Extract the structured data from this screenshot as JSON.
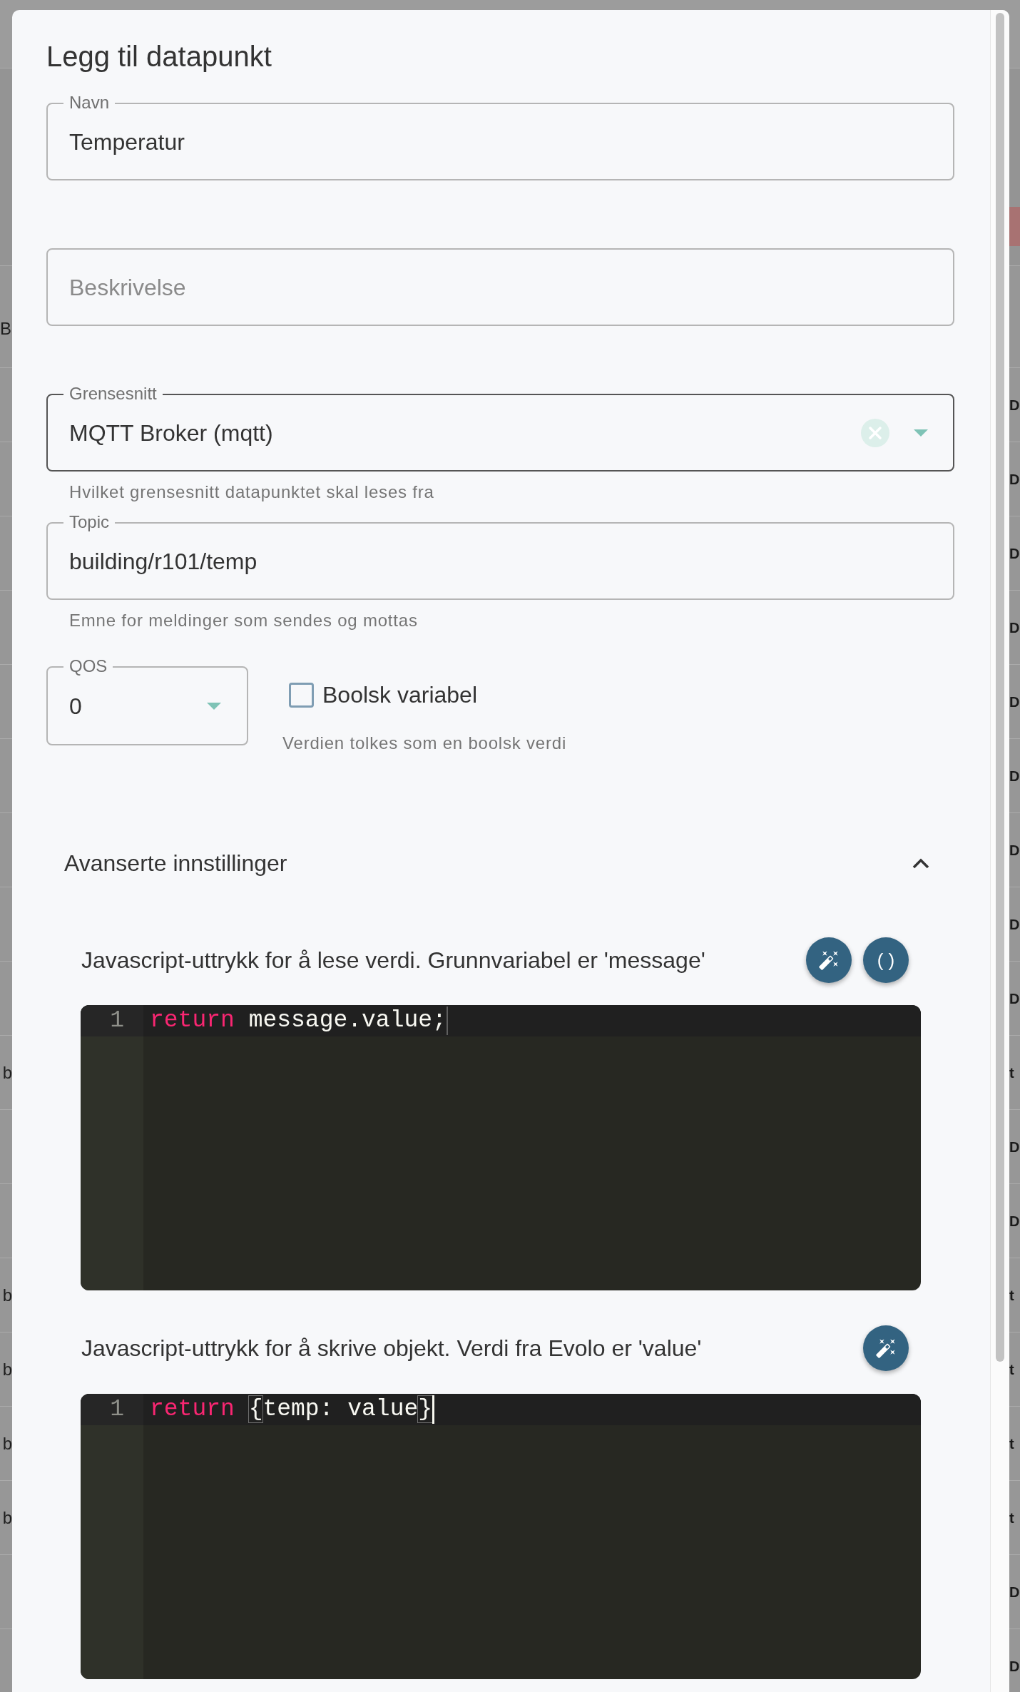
{
  "background_page": {
    "header_cell": "B",
    "rows": [
      {
        "right_cell": "D"
      },
      {
        "right_cell": "D"
      },
      {
        "right_cell": "D"
      },
      {
        "right_cell": "D"
      },
      {
        "right_cell": "D"
      },
      {
        "right_cell": "D"
      },
      {
        "right_cell": "D"
      },
      {
        "right_cell": "D"
      },
      {
        "right_cell": "D"
      },
      {
        "left_cell": "b",
        "right_cell": "t"
      },
      {
        "right_cell": "D"
      },
      {
        "right_cell": "D"
      },
      {
        "left_cell": "b",
        "right_cell": "t"
      },
      {
        "left_cell": "b",
        "right_cell": "t"
      },
      {
        "left_cell": "b",
        "right_cell": "t"
      },
      {
        "left_cell": "b",
        "right_cell": "t"
      },
      {
        "right_cell": "D"
      },
      {
        "right_cell": "D"
      }
    ]
  },
  "dialog": {
    "title": "Legg til datapunkt",
    "fields": [
      {
        "kind": "text",
        "label": "Navn",
        "value": "Temperatur",
        "hovered": false
      },
      {
        "kind": "text",
        "placeholder": "Beskrivelse",
        "hovered": false
      },
      {
        "kind": "select",
        "label": "Grensesnitt",
        "value": "MQTT Broker (mqtt)",
        "clearable": true,
        "helper": "Hvilket grensesnitt datapunktet skal leses fra",
        "hovered": true
      },
      {
        "kind": "text",
        "label": "Topic",
        "value": "building/r101/temp",
        "helper": "Emne for meldinger som sendes og mottas",
        "hovered": false
      }
    ],
    "qos": {
      "label": "QOS",
      "value": "0"
    },
    "checkbox": {
      "label": "Boolsk variabel",
      "checked": false,
      "helper": "Verdien tolkes som en boolsk verdi"
    },
    "accordion": {
      "title": "Avanserte innstillinger",
      "expanded": true,
      "sections": [
        {
          "label": "Javascript-uttrykk for å lese verdi. Grunnvariabel er 'message'",
          "buttons": [
            {
              "kind": "wand"
            },
            {
              "kind": "text",
              "label": "( )"
            }
          ],
          "editor": {
            "focused": false,
            "lines": [
              {
                "number": "1",
                "active": true,
                "tokens": [
                  {
                    "kind": "keyword",
                    "text": "return"
                  },
                  {
                    "kind": "plain",
                    "text": " message.value;"
                  }
                ]
              }
            ]
          }
        },
        {
          "label": "Javascript-uttrykk for å skrive objekt. Verdi fra Evolo er 'value'",
          "buttons": [
            {
              "kind": "wand"
            }
          ],
          "editor": {
            "focused": true,
            "lines": [
              {
                "number": "1",
                "active": true,
                "tokens": [
                  {
                    "kind": "keyword",
                    "text": "return "
                  },
                  {
                    "kind": "matched_bracket",
                    "text": "{"
                  },
                  {
                    "kind": "plain",
                    "text": "temp: value"
                  },
                  {
                    "kind": "matched_bracket",
                    "text": "}"
                  }
                ]
              }
            ]
          }
        }
      ]
    }
  }
}
